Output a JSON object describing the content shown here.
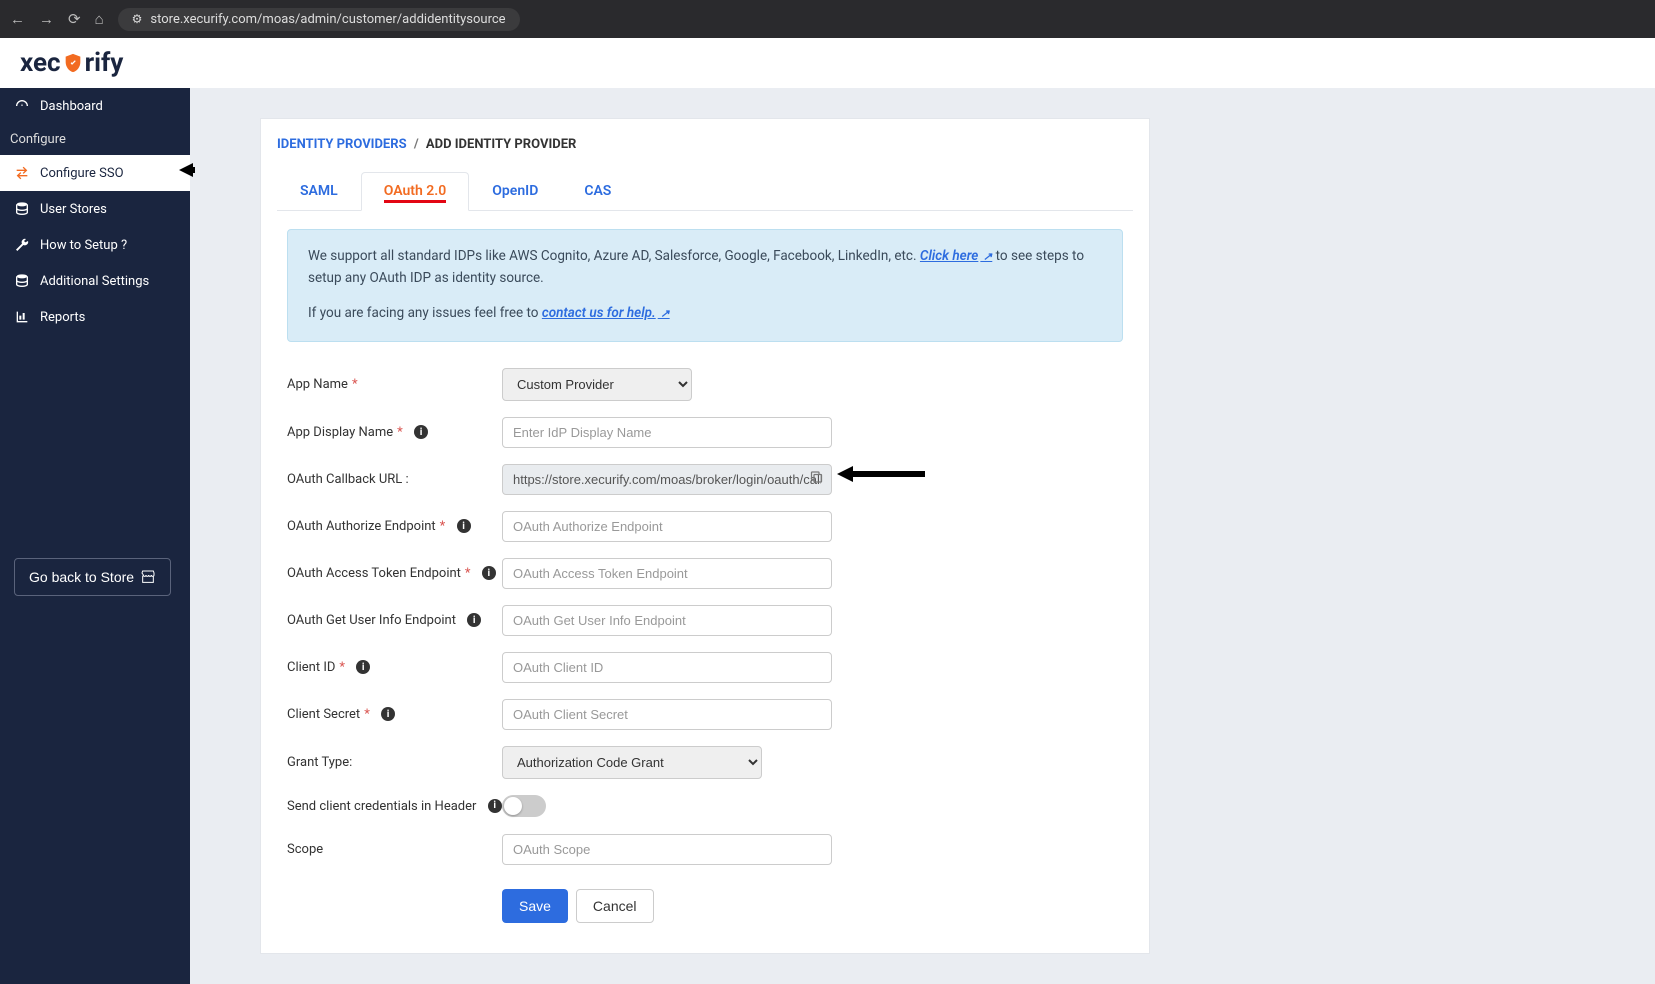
{
  "browser": {
    "url": "store.xecurify.com/moas/admin/customer/addidentitysource"
  },
  "logo": {
    "part1": "xec",
    "part2": "rify"
  },
  "sidebar": {
    "items": [
      {
        "icon": "dashboard",
        "label": "Dashboard"
      },
      {
        "section": true,
        "label": "Configure"
      },
      {
        "icon": "sso",
        "label": "Configure SSO",
        "active": true
      },
      {
        "icon": "db",
        "label": "User Stores"
      },
      {
        "icon": "wrench",
        "label": "How to Setup ?"
      },
      {
        "icon": "db",
        "label": "Additional Settings"
      },
      {
        "icon": "chart",
        "label": "Reports"
      }
    ],
    "go_back": "Go back to Store"
  },
  "breadcrumb": {
    "link": "IDENTITY PROVIDERS",
    "sep": "/",
    "current": "ADD IDENTITY PROVIDER"
  },
  "tabs": [
    {
      "label": "SAML"
    },
    {
      "label": "OAuth 2.0",
      "active": true
    },
    {
      "label": "OpenID"
    },
    {
      "label": "CAS"
    }
  ],
  "info": {
    "text1": "We support all standard IDPs like AWS Cognito, Azure AD, Salesforce, Google, Facebook, LinkedIn, etc. ",
    "link1": "Click here",
    "text2": " to see steps to setup any OAuth IDP as identity source.",
    "text3": "If you are facing any issues feel free to ",
    "link2": "contact us for help."
  },
  "form": {
    "app_name": {
      "label": "App Name",
      "selected": "Custom Provider"
    },
    "display_name": {
      "label": "App Display Name",
      "placeholder": "Enter IdP Display Name"
    },
    "callback": {
      "label": "OAuth Callback URL :",
      "value": "https://store.xecurify.com/moas/broker/login/oauth/callback"
    },
    "authorize": {
      "label": "OAuth Authorize Endpoint",
      "placeholder": "OAuth Authorize Endpoint"
    },
    "token": {
      "label": "OAuth Access Token Endpoint",
      "placeholder": "OAuth Access Token Endpoint"
    },
    "userinfo": {
      "label": "OAuth Get User Info Endpoint",
      "placeholder": "OAuth Get User Info Endpoint"
    },
    "client_id": {
      "label": "Client ID",
      "placeholder": "OAuth Client ID"
    },
    "client_secret": {
      "label": "Client Secret",
      "placeholder": "OAuth Client Secret"
    },
    "grant_type": {
      "label": "Grant Type:",
      "selected": "Authorization Code Grant"
    },
    "send_header": {
      "label": "Send client credentials in Header"
    },
    "scope": {
      "label": "Scope",
      "placeholder": "OAuth Scope"
    },
    "save": "Save",
    "cancel": "Cancel"
  }
}
